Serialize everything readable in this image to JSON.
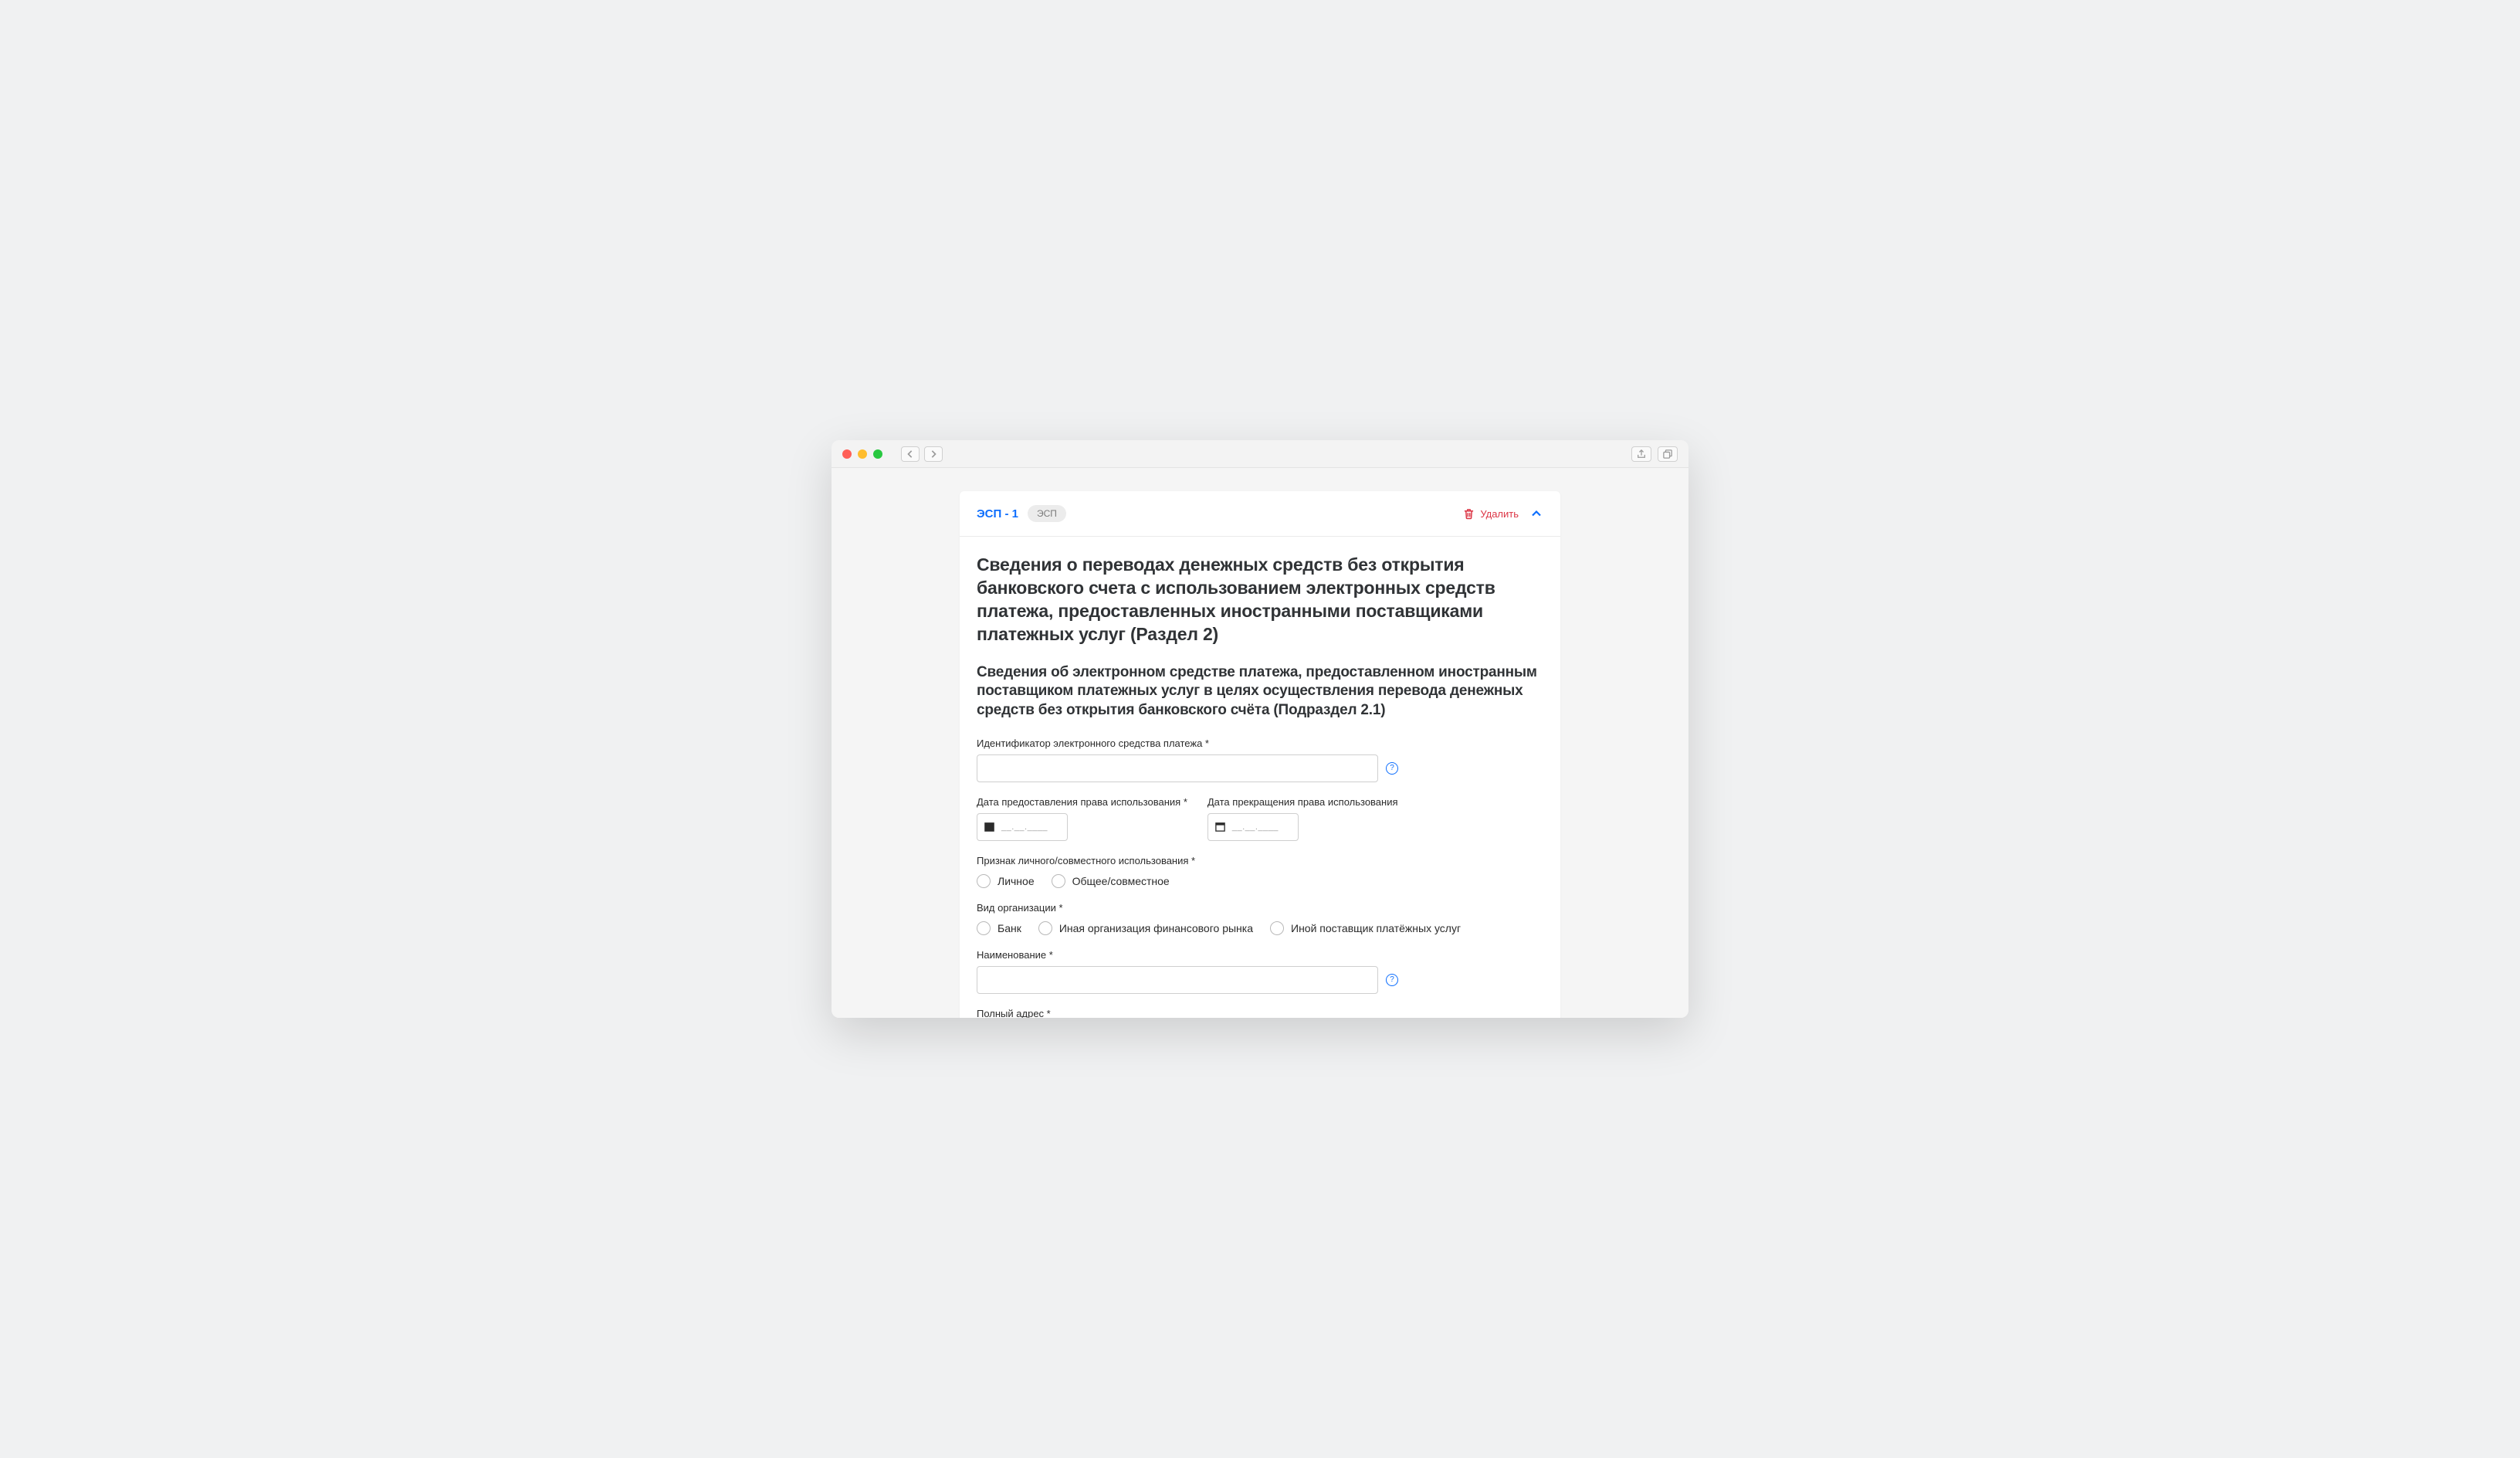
{
  "header": {
    "title": "ЭСП - 1",
    "badge": "ЭСП",
    "delete": "Удалить"
  },
  "section_title": "Сведения о переводах денежных средств без открытия банковского счета с использованием электронных средств платежа, предоставленных иностранными поставщиками платежных услуг (Раздел 2)",
  "subsection_title": "Сведения об электронном средстве платежа, предоставленном иностранным поставщиком платежных услуг в целях осуществления перевода денежных средств без открытия банковского счёта (Подраздел 2.1)",
  "fields": {
    "identifier": {
      "label": "Идентификатор электронного средства платежа *"
    },
    "date_grant": {
      "label": "Дата предоставления права использования *",
      "placeholder": "__.__.____"
    },
    "date_end": {
      "label": "Дата прекращения права использования",
      "placeholder": "__.__.____"
    },
    "usage": {
      "label": "Признак личного/совместного использования *",
      "options": [
        "Личное",
        "Общее/совместное"
      ]
    },
    "org_type": {
      "label": "Вид организации *",
      "options": [
        "Банк",
        "Иная организация финансового рынка",
        "Иной поставщик платёжных услуг"
      ]
    },
    "name": {
      "label": "Наименование *"
    },
    "address": {
      "label": "Полный адрес *"
    }
  }
}
